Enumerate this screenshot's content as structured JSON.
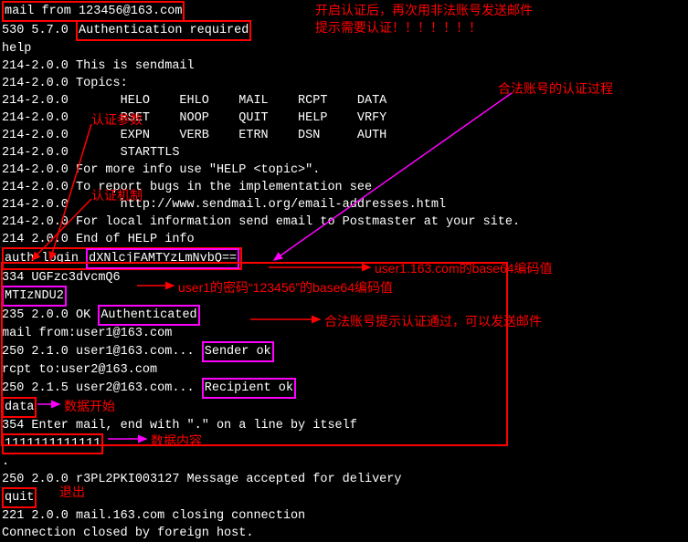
{
  "lines": {
    "l1_cmd": "mail from 123456@163.com",
    "l2_code": "530 5.7.0 ",
    "l2_auth": "Authentication required",
    "l3": "help",
    "l4": "214-2.0.0 This is sendmail",
    "l5": "214-2.0.0 Topics:",
    "l6": "214-2.0.0       HELO    EHLO    MAIL    RCPT    DATA",
    "l7": "214-2.0.0       RSET    NOOP    QUIT    HELP    VRFY",
    "l8": "214-2.0.0       EXPN    VERB    ETRN    DSN     AUTH",
    "l9": "214-2.0.0       STARTTLS",
    "l10": "214-2.0.0 For more info use \"HELP <topic>\".",
    "l11": "214-2.0.0 To report bugs in the implementation see",
    "l12": "214-2.0.0       http://www.sendmail.org/email-addresses.html",
    "l13": "214-2.0.0 For local information send email to Postmaster at your site.",
    "l14": "214 2.0.0 End of HELP info",
    "l15_a": "auth login",
    "l15_b": "dXNlcjFAMTYzLmNvbQ==",
    "l16": "334 UGFzc3dvcmQ6",
    "l17": "MTIzNDU2",
    "l18_a": "235 2.0.0 OK ",
    "l18_b": "Authenticated",
    "l19": "mail from:user1@163.com",
    "l20_a": "250 2.1.0 user1@163.com... ",
    "l20_b": "Sender ok",
    "l21": "rcpt to:user2@163.com",
    "l22_a": "250 2.1.5 user2@163.com... ",
    "l22_b": "Recipient ok",
    "l23": "data",
    "l24": "354 Enter mail, end with \".\" on a line by itself",
    "l25": "1111111111111",
    "l26": ".",
    "l27": "250 2.0.0 r3PL2PKI003127 Message accepted for delivery",
    "l28": "quit",
    "l29": "221 2.0.0 mail.163.com closing connection",
    "l30": "Connection closed by foreign host."
  },
  "annot": {
    "a1": "开启认证后，再次用非法账号发送邮件",
    "a2": "提示需要认证！！！！！！！",
    "a3": "合法账号的认证过程",
    "a4": "认证参数",
    "a5": "认证机制",
    "a6": "user1.163.com的base64编码值",
    "a7": "user1的密码“123456”的base64编码值",
    "a8": "合法账号提示认证通过，可以发送邮件",
    "a9": "数据开始",
    "a10": "数据内容",
    "a11": "退出"
  }
}
